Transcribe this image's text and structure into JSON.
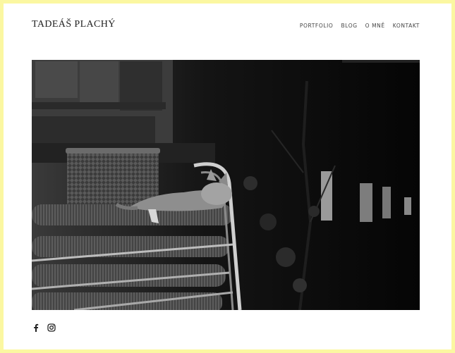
{
  "site": {
    "title": "TADEÁŠ PLACHÝ"
  },
  "nav": {
    "items": [
      "PORTFOLIO",
      "BLOG",
      "O MNĚ",
      "KONTAKT"
    ]
  },
  "photo": {
    "icon": "cat-on-chair-photo"
  },
  "social": {
    "icons": [
      "facebook-icon",
      "instagram-icon"
    ]
  }
}
